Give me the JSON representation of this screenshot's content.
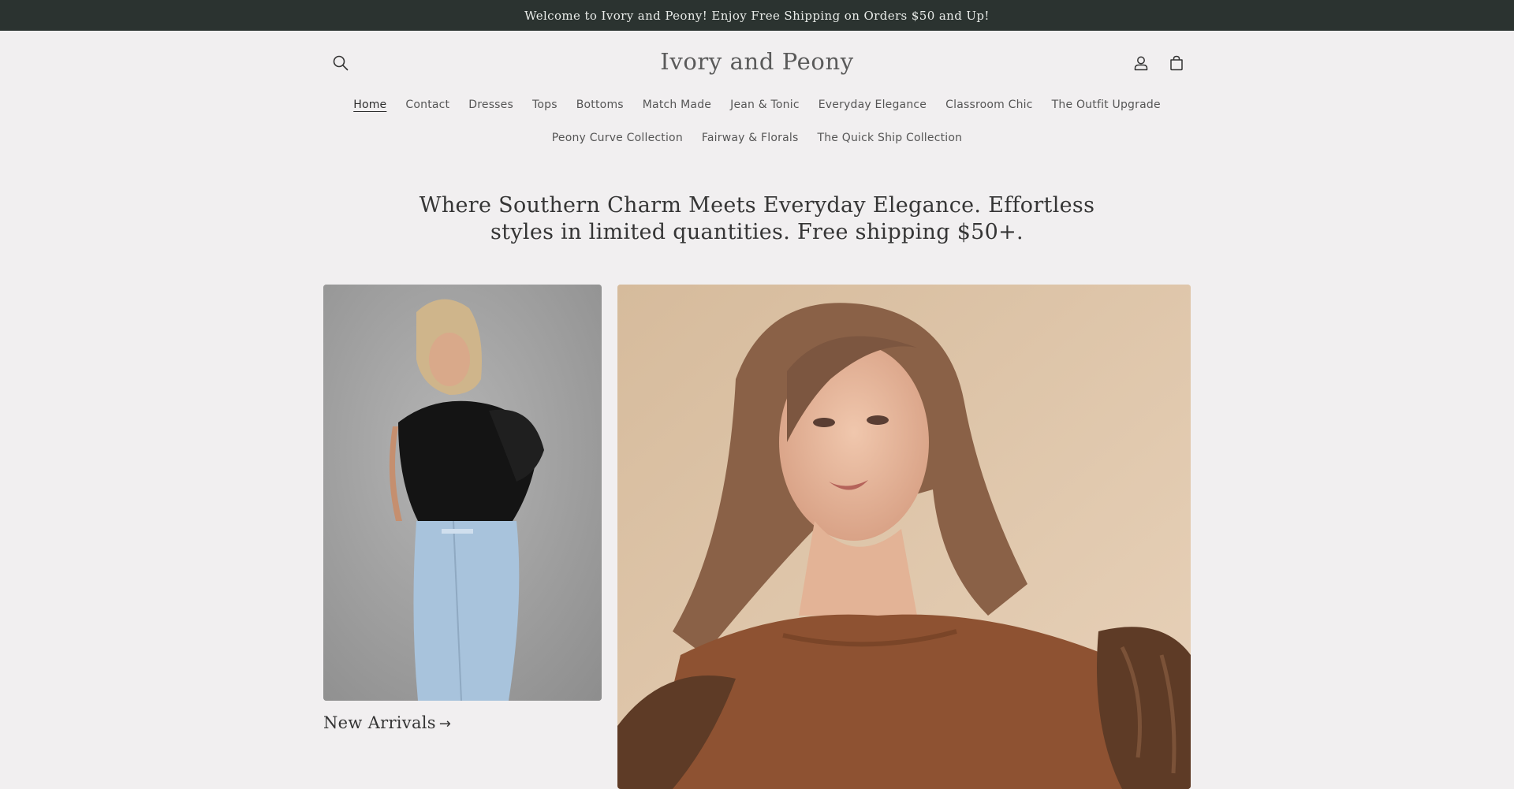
{
  "announcement": {
    "text": "Welcome to Ivory and Peony! Enjoy Free Shipping on Orders $50 and Up!"
  },
  "header": {
    "logo": "Ivory and Peony",
    "icons": {
      "search": "search-icon",
      "account": "account-icon",
      "cart": "cart-icon"
    }
  },
  "nav": {
    "row1": [
      {
        "label": "Home",
        "active": true
      },
      {
        "label": "Contact"
      },
      {
        "label": "Dresses"
      },
      {
        "label": "Tops"
      },
      {
        "label": "Bottoms"
      },
      {
        "label": "Match Made"
      },
      {
        "label": "Jean & Tonic"
      },
      {
        "label": "Everyday Elegance"
      },
      {
        "label": "Classroom Chic"
      },
      {
        "label": "The Outfit Upgrade"
      }
    ],
    "row2": [
      {
        "label": "Peony Curve Collection"
      },
      {
        "label": "Fairway & Florals"
      },
      {
        "label": "The Quick Ship Collection"
      }
    ]
  },
  "hero": {
    "line1": "Where Southern Charm Meets Everyday Elegance. Effortless",
    "line2": "styles in limited quantities. Free shipping $50+."
  },
  "collections": [
    {
      "caption": "New Arrivals",
      "arrow": "→"
    }
  ],
  "colors": {
    "announcement_bg": "#2b3330",
    "page_bg": "#f1eff0",
    "text": "#353535"
  }
}
